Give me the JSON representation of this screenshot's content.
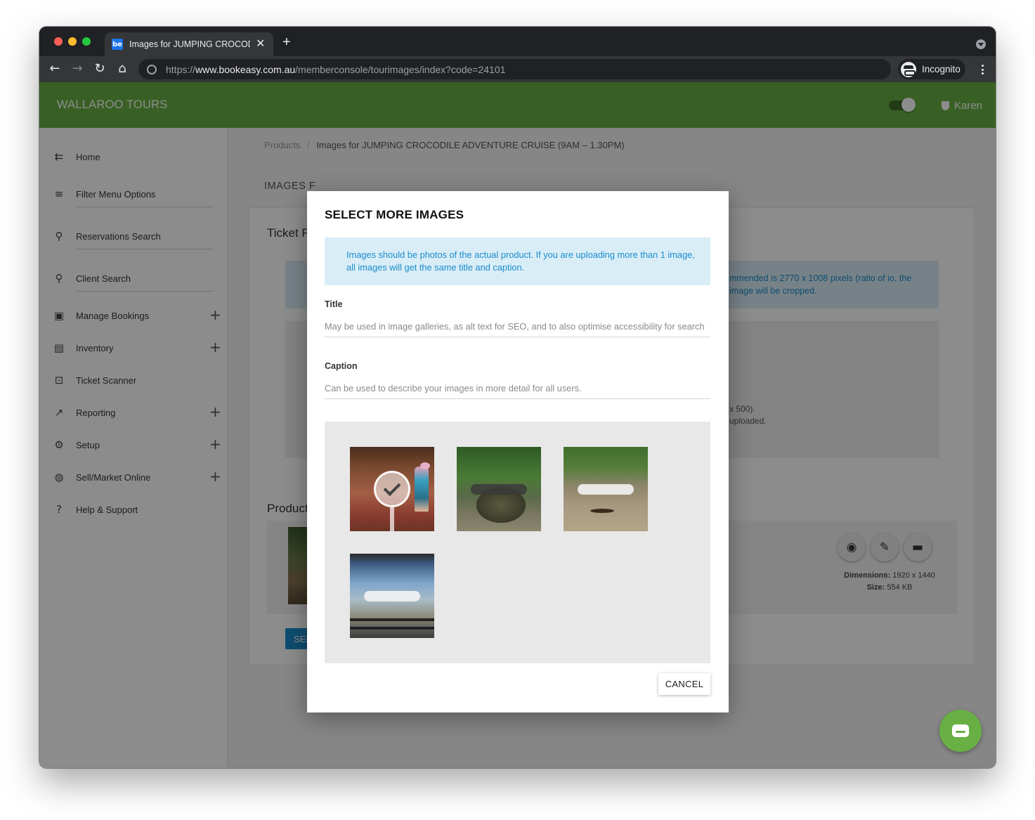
{
  "browser": {
    "tab_title": "Images for JUMPING CROCODILE ADVENTURE CRUISE",
    "tab_favicon_text": "be",
    "new_tab": "+",
    "close": "✕",
    "url_scheme": "https://",
    "url_host": "www.bookeasy.com.au",
    "url_path": "/memberconsole/tourimages/index?code=24101",
    "incognito_label": "Incognito"
  },
  "appbar": {
    "brand": "WALLAROO TOURS",
    "user_name": "Karen",
    "accent_color": "#68b043"
  },
  "sidebar": {
    "items": [
      {
        "label": "Home",
        "icon": "menu-open-icon",
        "glyph": "⇇"
      },
      {
        "label": "Filter Menu Options",
        "icon": "filter-icon",
        "glyph": "≡"
      },
      {
        "label": "Reservations Search",
        "icon": "search-icon",
        "glyph": "⚲"
      },
      {
        "label": "Client Search",
        "icon": "search-icon",
        "glyph": "⚲"
      },
      {
        "label": "Manage Bookings",
        "icon": "calendar-check-icon",
        "glyph": "▣",
        "expand": "+"
      },
      {
        "label": "Inventory",
        "icon": "clipboard-icon",
        "glyph": "▤",
        "expand": "+"
      },
      {
        "label": "Ticket Scanner",
        "icon": "scanner-icon",
        "glyph": "⊡"
      },
      {
        "label": "Reporting",
        "icon": "trending-up-icon",
        "glyph": "↗",
        "expand": "+"
      },
      {
        "label": "Setup",
        "icon": "gear-icon",
        "glyph": "⚙",
        "expand": "+"
      },
      {
        "label": "Sell/Market Online",
        "icon": "globe-icon",
        "glyph": "◍",
        "expand": "+"
      },
      {
        "label": "Help & Support",
        "icon": "help-icon",
        "glyph": "?"
      }
    ]
  },
  "content": {
    "breadcrumb_root": "Products",
    "breadcrumb_sep": "/",
    "breadcrumb_current": "Images for JUMPING CROCODILE ADVENTURE CRUISE (9AM – 1.30PM)",
    "page_title": "IMAGES F",
    "card_heading_1": "Ticket F",
    "info_blue_text": "mmended is 2770 x 1008 pixels (ratio of io, the image will be cropped.",
    "dropzone_text_line1": "x 500).",
    "dropzone_text_line2": "uploaded.",
    "card_heading_2": "Product",
    "dimensions_label": "Dimensions:",
    "dimensions_value": "1920 x 1440",
    "size_label": "Size:",
    "size_value": "554 KB",
    "select_button": "SEL"
  },
  "modal": {
    "title": "SELECT MORE IMAGES",
    "info": "Images should be photos of the actual product. If you are uploading more than 1 image, all images will get the same title and caption.",
    "title_label": "Title",
    "title_placeholder": "May be used in image galleries, as alt text for SEO, and to also optimise accessibility for search",
    "caption_label": "Caption",
    "caption_placeholder": "Can be used to describe your images in more detail for all users.",
    "images": [
      {
        "name": "walkway-photo",
        "selected": true
      },
      {
        "name": "crocodile-jump-photo",
        "selected": false
      },
      {
        "name": "river-eagle-photo",
        "selected": false
      },
      {
        "name": "boat-crocodile-photo",
        "selected": false
      }
    ],
    "cancel_label": "CANCEL"
  }
}
